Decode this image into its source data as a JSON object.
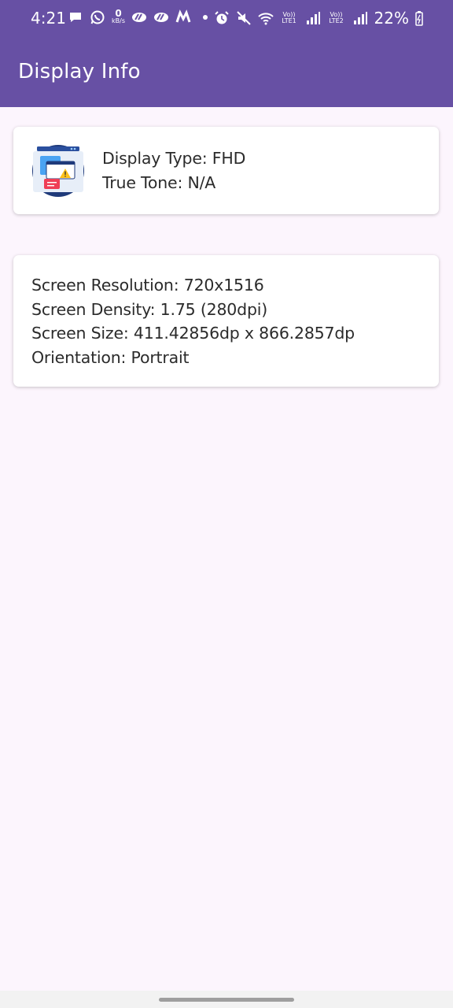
{
  "status_bar": {
    "time": "4:21",
    "data_speed_value": "0",
    "data_speed_unit": "kB/s",
    "sim1_label": "Vo)) LTE1",
    "sim2_label": "Vo)) LTE2",
    "battery": "22%"
  },
  "app_bar": {
    "title": "Display Info",
    "color": "#6750a4"
  },
  "display_card": {
    "icon": "display-monitor-icon",
    "display_type": "Display Type: FHD",
    "true_tone": "True Tone: N/A"
  },
  "screen_card": {
    "resolution": "Screen Resolution: 720x1516",
    "density": "Screen Density: 1.75 (280dpi)",
    "size": "Screen Size: 411.42856dp x 866.2857dp",
    "orientation": "Orientation: Portrait"
  }
}
